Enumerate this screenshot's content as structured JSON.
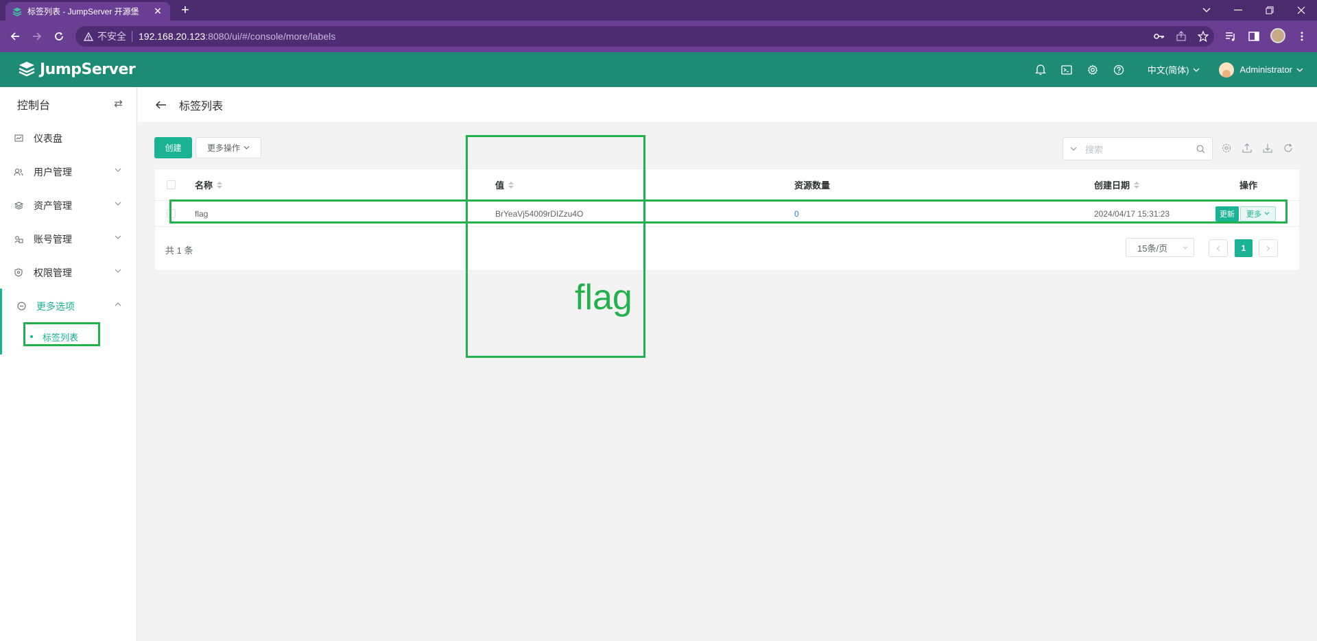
{
  "browser": {
    "tab_title": "标签列表 - JumpServer 开源堡",
    "insecure_label": "不安全",
    "url_host": "192.168.20.123",
    "url_path": ":8080/ui/#/console/more/labels"
  },
  "header": {
    "brand": "JumpServer",
    "language": "中文(简体)",
    "username": "Administrator"
  },
  "sidebar": {
    "title": "控制台",
    "items": [
      {
        "label": "仪表盘"
      },
      {
        "label": "用户管理"
      },
      {
        "label": "资产管理"
      },
      {
        "label": "账号管理"
      },
      {
        "label": "权限管理"
      },
      {
        "label": "更多选项"
      }
    ],
    "sub_items": [
      {
        "label": "标签列表"
      }
    ]
  },
  "page": {
    "title": "标签列表"
  },
  "toolbar": {
    "create_label": "创建",
    "more_actions_label": "更多操作",
    "search_placeholder": "搜索"
  },
  "table": {
    "columns": [
      "名称",
      "值",
      "资源数量",
      "创建日期",
      "操作"
    ],
    "rows": [
      {
        "name": "flag",
        "value": "BrYeaVj54009rDIZzu4O",
        "resource_count": "0",
        "created": "2024/04/17 15:31:23",
        "update_label": "更新",
        "more_label": "更多"
      }
    ]
  },
  "pagination": {
    "total": "共 1 条",
    "page_size": "15条/页",
    "current_page": "1"
  },
  "annotation": {
    "label": "flag",
    "color": "#22b14c"
  },
  "colors": {
    "brand": "#1e8b74",
    "accent": "#1ab394",
    "browser": "#6a3f93"
  }
}
